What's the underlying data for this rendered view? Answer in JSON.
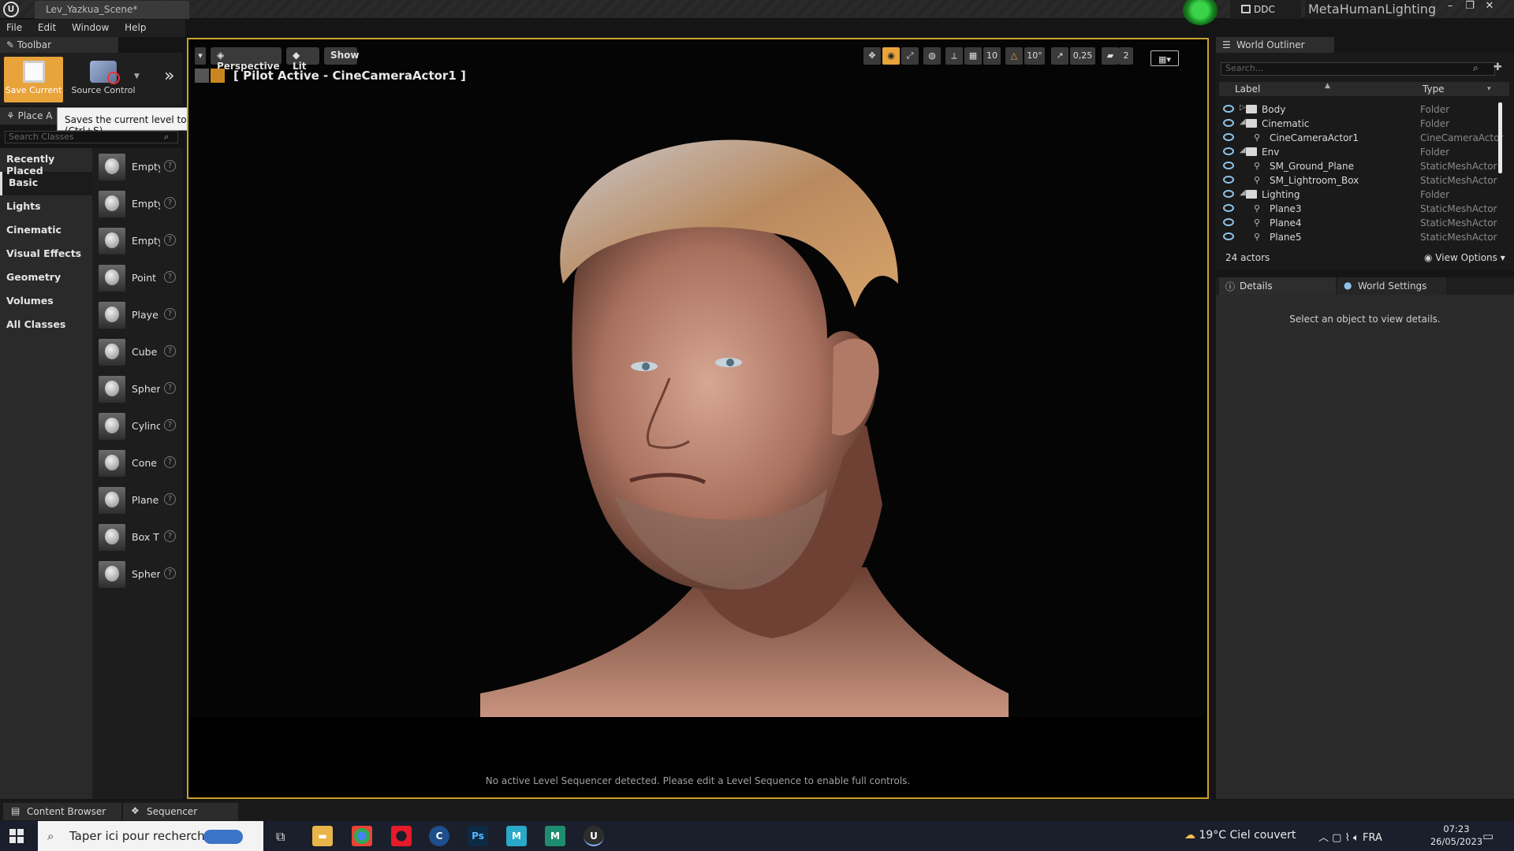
{
  "titlebar": {
    "document_tab": "Lev_Yazkua_Scene*",
    "ddc_label": "DDC",
    "project_name": "MetaHumanLighting",
    "minimize": "–",
    "restore": "❐",
    "close": "✕"
  },
  "menubar": {
    "items": [
      "File",
      "Edit",
      "Window",
      "Help"
    ]
  },
  "toolbar": {
    "tab_label": "Toolbar",
    "save_label": "Save Current",
    "source_control_label": "Source Control",
    "tooltip": "Saves the current level to disk (Ctrl+S)"
  },
  "place_actors": {
    "tab_label": "Place A",
    "search_placeholder": "Search Classes",
    "categories": [
      "Recently Placed",
      "Basic",
      "Lights",
      "Cinematic",
      "Visual Effects",
      "Geometry",
      "Volumes",
      "All Classes"
    ],
    "active_category": "Basic",
    "classes": [
      "Empty",
      "Empty",
      "Empty",
      "Point",
      "Playe",
      "Cube",
      "Spher",
      "Cylinc",
      "Cone",
      "Plane",
      "Box T",
      "Spher"
    ]
  },
  "viewport": {
    "perspective_label": "Perspective",
    "lit_label": "Lit",
    "show_label": "Show",
    "pilot_label": "[ Pilot Active - CineCameraActor1 ]",
    "grid_snap": "10",
    "rotation_snap": "10°",
    "scale_snap": "0,25",
    "camera_speed": "2",
    "sequencer_note": "No active Level Sequencer detected. Please edit a Level Sequence to enable full controls."
  },
  "outliner": {
    "tab_label": "World Outliner",
    "search_placeholder": "Search...",
    "col_label": "Label",
    "col_type": "Type",
    "rows": [
      {
        "label": "Body",
        "type": "Folder",
        "kind": "folder",
        "depth": 0
      },
      {
        "label": "Cinematic",
        "type": "Folder",
        "kind": "folder",
        "depth": 0
      },
      {
        "label": "CineCameraActor1",
        "type": "CineCameraActor",
        "kind": "actor",
        "depth": 1
      },
      {
        "label": "Env",
        "type": "Folder",
        "kind": "folder",
        "depth": 0
      },
      {
        "label": "SM_Ground_Plane",
        "type": "StaticMeshActor",
        "kind": "actor",
        "depth": 1
      },
      {
        "label": "SM_Lightroom_Box",
        "type": "StaticMeshActor",
        "kind": "actor",
        "depth": 1
      },
      {
        "label": "Lighting",
        "type": "Folder",
        "kind": "folder",
        "depth": 0
      },
      {
        "label": "Plane3",
        "type": "StaticMeshActor",
        "kind": "actor",
        "depth": 1
      },
      {
        "label": "Plane4",
        "type": "StaticMeshActor",
        "kind": "actor",
        "depth": 1
      },
      {
        "label": "Plane5",
        "type": "StaticMeshActor",
        "kind": "actor",
        "depth": 1
      }
    ],
    "actor_count": "24 actors",
    "view_options": "View Options"
  },
  "details": {
    "tab_label": "Details",
    "world_settings_label": "World Settings",
    "empty_message": "Select an object to view details."
  },
  "bottom_tabs": {
    "content_browser": "Content Browser",
    "sequencer": "Sequencer"
  },
  "taskbar": {
    "search_text": "Taper ici pour rechercher",
    "weather": "19°C  Ciel couvert",
    "language": "FRA",
    "time": "07:23",
    "date": "26/05/2023"
  },
  "colors": {
    "accent_orange": "#e8a33a",
    "viewport_border": "#c9a227",
    "eye_blue": "#8fc3e8",
    "taskbar": "#1a1f2b"
  }
}
